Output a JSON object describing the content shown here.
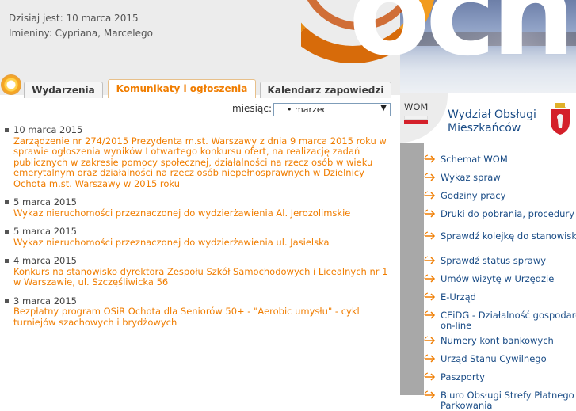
{
  "header": {
    "date_line": "Dzisiaj jest: 10 marca 2015",
    "names_line": "Imieniny: Cypriana, Marcelego",
    "banner_text": "och"
  },
  "tabs": [
    {
      "label": "Wydarzenia"
    },
    {
      "label": "Komunikaty i ogłoszenia"
    },
    {
      "label": "Kalendarz zapowiedzi"
    }
  ],
  "filter": {
    "label": "miesiąc:",
    "selected": "• marzec"
  },
  "news": [
    {
      "date": "10 marca 2015",
      "title": "Zarządzenie nr 274/2015 Prezydenta m.st. Warszawy z dnia 9 marca 2015 roku w sprawie ogłoszenia wyników I otwartego konkursu ofert, na realizację zadań publicznych w zakresie pomocy społecznej, działalności na rzecz osób w wieku emerytalnym oraz działalności na rzecz osób niepełnosprawnych w Dzielnicy Ochota m.st. Warszawy w 2015 roku"
    },
    {
      "date": "5 marca 2015",
      "title": "Wykaz nieruchomości przeznaczonej do wydzierżawienia Al. Jerozolimskie"
    },
    {
      "date": "5 marca 2015",
      "title": "Wykaz nieruchomości przeznaczonej do wydzierżawienia ul. Jasielska"
    },
    {
      "date": "4 marca 2015",
      "title": "Konkurs na stanowisko dyrektora Zespołu Szkół Samochodowych i Licealnych nr 1 w Warszawie, ul. Szczęśliwicka 56"
    },
    {
      "date": "3 marca 2015",
      "title": "Bezpłatny program OSiR Ochota dla Seniorów 50+ - \"Aerobic umysłu\" - cykl turniejów szachowych i brydżowych"
    }
  ],
  "sidebar": {
    "wom_label": "WOM",
    "title_line1": "Wydział Obsługi",
    "title_line2": "Mieszkańców",
    "items": [
      {
        "label": "Schemat WOM"
      },
      {
        "label": "Wykaz spraw"
      },
      {
        "label": "Godziny pracy"
      },
      {
        "label": "Druki do pobrania, procedury"
      },
      {
        "label": "Sprawdź kolejkę do stanowisk"
      },
      {
        "label": "Sprawdź status sprawy"
      },
      {
        "label": "Umów wizytę w Urzędzie"
      },
      {
        "label": "E-Urząd"
      },
      {
        "label": "CEiDG - Działalność gospodarcza on-line"
      },
      {
        "label": "Numery kont bankowych"
      },
      {
        "label": "Urząd Stanu Cywilnego"
      },
      {
        "label": "Paszporty"
      },
      {
        "label": "Biuro Obsługi Strefy Płatnego Parkowania"
      }
    ]
  },
  "colors": {
    "accent_orange": "#f07d00",
    "link_blue": "#1a4c86",
    "flag_red": "#d4202a"
  }
}
